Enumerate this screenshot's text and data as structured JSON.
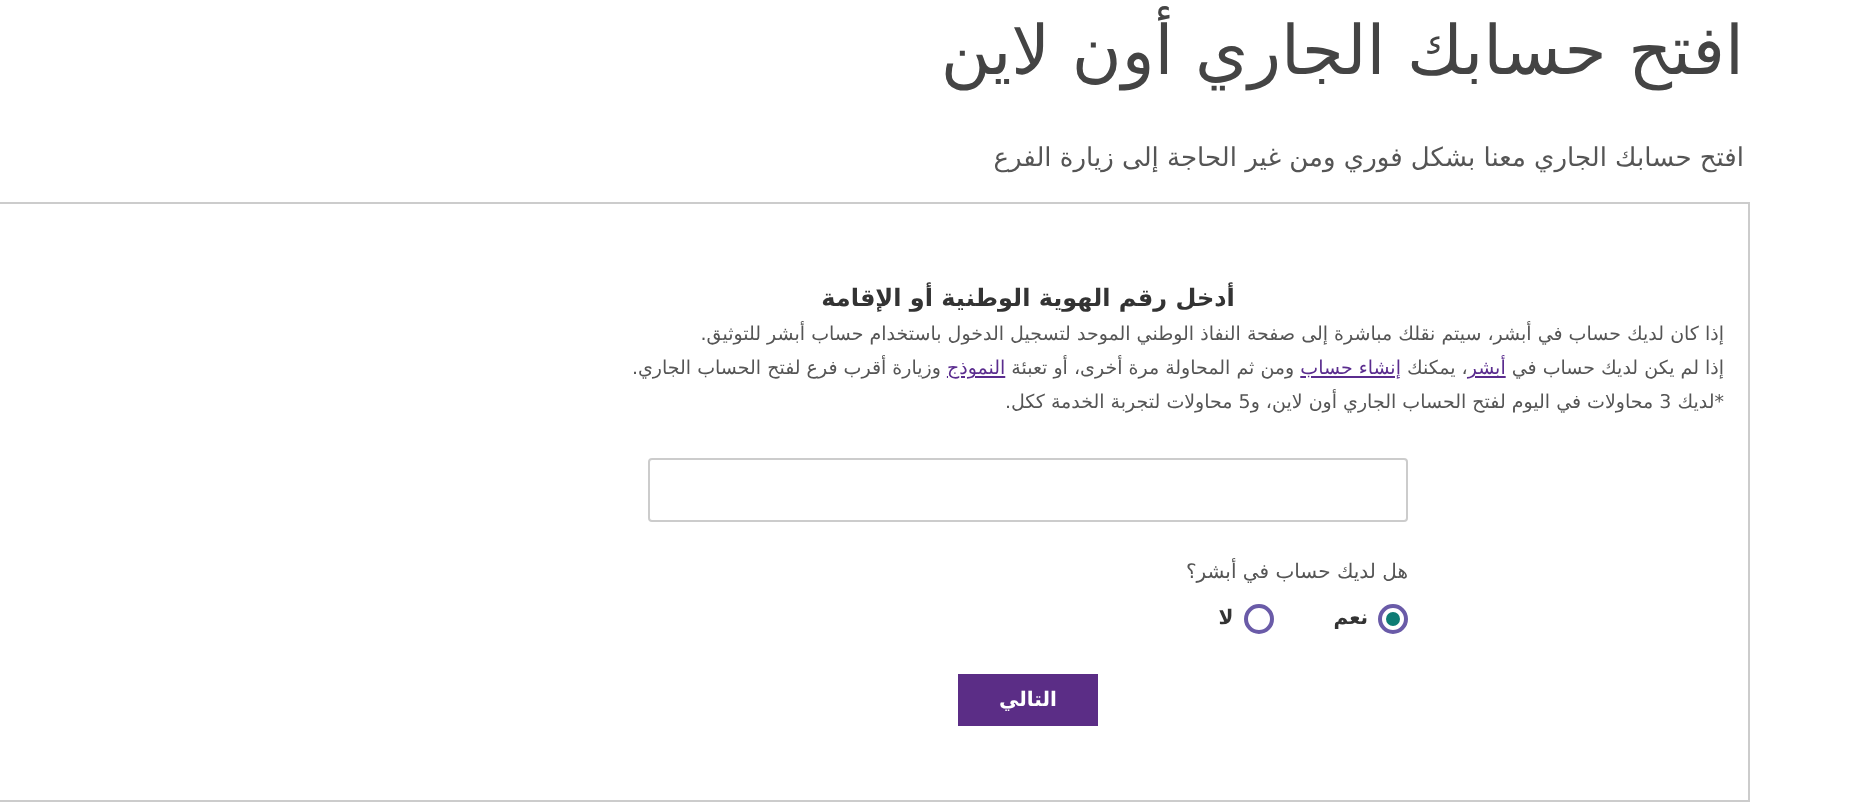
{
  "page": {
    "title": "افتح حسابك الجاري أون لاين",
    "subtitle": "افتح حسابك الجاري معنا بشكل فوري ومن غير الحاجة إلى زيارة الفرع"
  },
  "form": {
    "heading": "أدخل رقم الهوية الوطنية أو الإقامة",
    "paragraphs": [
      [
        {
          "text": "إذا كان لديك حساب في أبشر، سيتم نقلك مباشرة إلى صفحة النفاذ الوطني الموحد لتسجيل الدخول باستخدام حساب أبشر للتوثيق.",
          "link": false
        }
      ],
      [
        {
          "text": "إذا لم يكن لديك حساب في ",
          "link": false
        },
        {
          "text": "أبشر",
          "link": true
        },
        {
          "text": "، يمكنك ",
          "link": false
        },
        {
          "text": "إنشاء حساب",
          "link": true
        },
        {
          "text": " ومن ثم المحاولة مرة أخرى، أو تعبئة ",
          "link": false
        },
        {
          "text": "النموذج",
          "link": true
        },
        {
          "text": " وزيارة أقرب فرع لفتح الحساب الجاري.",
          "link": false
        }
      ],
      [
        {
          "text": "*لديك 3 محاولات في اليوم لفتح الحساب الجاري أون لاين، و5 محاولات لتجربة الخدمة ككل.",
          "link": false
        }
      ]
    ],
    "question": "هل لديك حساب في أبشر؟",
    "options": [
      {
        "label": "نعم",
        "selected": true
      },
      {
        "label": "لا",
        "selected": false
      }
    ],
    "next_button": "التالي"
  }
}
